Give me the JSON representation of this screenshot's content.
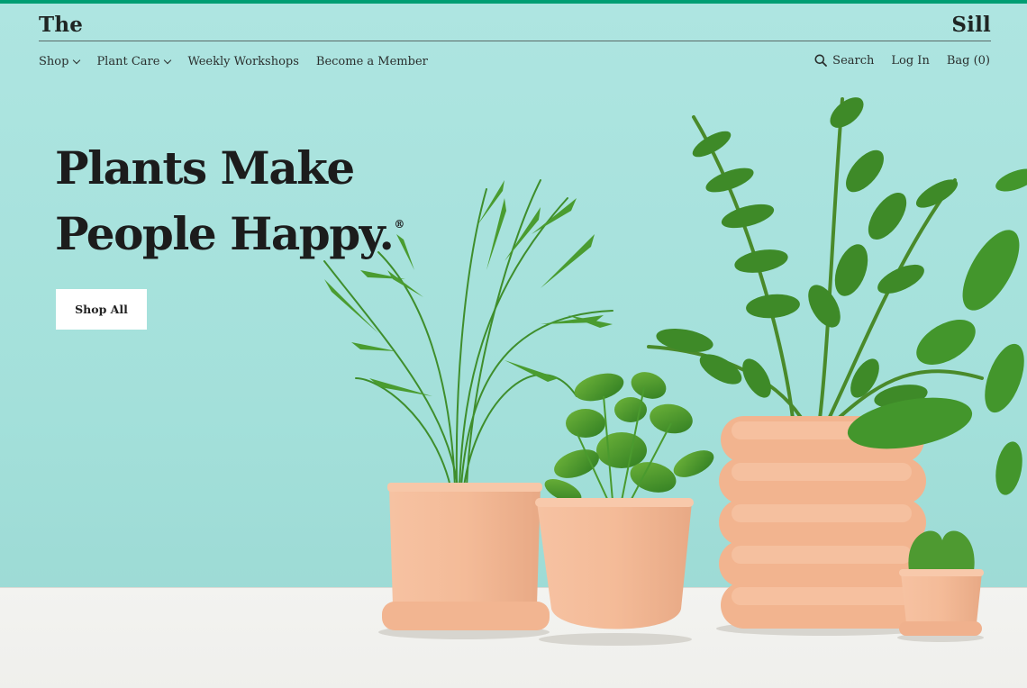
{
  "brand": {
    "left": "The",
    "right": "Sill"
  },
  "nav": {
    "items": [
      {
        "label": "Shop",
        "dropdown": true
      },
      {
        "label": "Plant Care",
        "dropdown": true
      },
      {
        "label": "Weekly Workshops",
        "dropdown": false
      },
      {
        "label": "Become a Member",
        "dropdown": false
      }
    ],
    "right": {
      "search": "Search",
      "login": "Log In",
      "bag": "Bag (0)"
    }
  },
  "hero": {
    "line1": "Plants Make",
    "line2": "People Happy.",
    "reg_mark": "®",
    "cta": "Shop All"
  },
  "colors": {
    "accent_bar": "#009e73",
    "background": "#a9e3de",
    "pot": "#f2b896",
    "leaf": "#3f8f2a"
  },
  "icons": [
    "search-icon",
    "chevron-down-icon"
  ]
}
